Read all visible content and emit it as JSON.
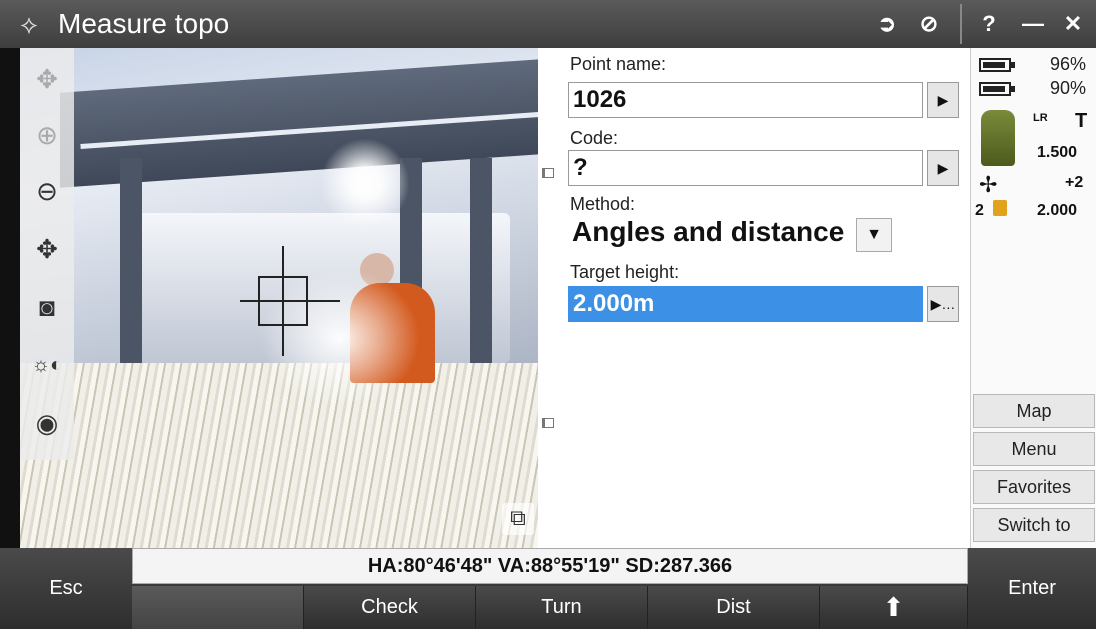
{
  "titlebar": {
    "title": "Measure topo",
    "help_label": "?",
    "minimize_label": "—",
    "close_label": "✕"
  },
  "form": {
    "point_name_label": "Point name:",
    "point_name_value": "1026",
    "code_label": "Code:",
    "code_value": "?",
    "method_label": "Method:",
    "method_value": "Angles and distance",
    "target_height_label": "Target height:",
    "target_height_value": "2.000m"
  },
  "status": {
    "battery1": "96%",
    "battery2": "90%",
    "instrument_code": "LR",
    "instrument_mode": "T",
    "instrument_height": "1.500",
    "prism_constant": "+2",
    "target_number": "2",
    "target_height": "2.000"
  },
  "side_buttons": [
    "Map",
    "Menu",
    "Favorites",
    "Switch to"
  ],
  "readout": "HA:80°46'48\"  VA:88°55'19\"  SD:287.366",
  "softkeys": {
    "esc": "Esc",
    "check": "Check",
    "turn": "Turn",
    "dist": "Dist",
    "enter": "Enter"
  },
  "icons": {
    "app": "survey-app-icon",
    "tracking": "tracking-icon",
    "no-sign": "no-sign-icon"
  }
}
